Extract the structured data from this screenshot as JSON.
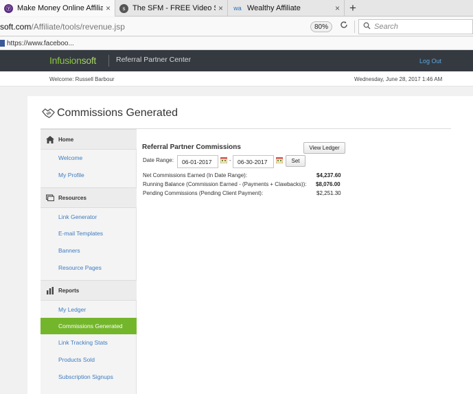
{
  "browser": {
    "tabs": [
      {
        "title": "Make Money Online Affiliate",
        "close": "×"
      },
      {
        "title": "The SFM - FREE Video Series",
        "close": "×"
      },
      {
        "title": "Wealthy Affiliate",
        "close": "×"
      }
    ],
    "new_tab": "+",
    "url_host": "soft.com",
    "url_path": "/Affiliate/tools/revenue.jsp",
    "zoom": "80%",
    "search_placeholder": "Search",
    "bookmark": "https://www.faceboo..."
  },
  "header": {
    "logo_main": "Infusion",
    "logo_soft": "soft",
    "center_name": "Referral Partner Center",
    "logout": "Log Out"
  },
  "welcome": {
    "text": "Welcome: Russell Barbour",
    "datetime": "Wednesday, June 28, 2017 1:46 AM"
  },
  "page": {
    "title": "Commissions Generated"
  },
  "sidebar": {
    "home": "Home",
    "home_items": [
      "Welcome",
      "My Profile"
    ],
    "resources": "Resources",
    "resource_items": [
      "Link Generator",
      "E-mail Templates",
      "Banners",
      "Resource Pages"
    ],
    "reports": "Reports",
    "report_items": [
      "My Ledger",
      "Commissions Generated",
      "Link Tracking Stats",
      "Products Sold",
      "Subscription Signups"
    ]
  },
  "main": {
    "heading": "Referral Partner Commissions",
    "view_ledger": "View Ledger",
    "date_range_label": "Date Range:",
    "start_date": "06-01-2017",
    "end_date": "06-30-2017",
    "dash": "-",
    "set": "Set",
    "rows": [
      {
        "label": "Net Commissions Earned (In Date Range):",
        "value": "$4,237.60"
      },
      {
        "label": "Running Balance (Commission Earned - (Payments + Clawbacks)):",
        "value": "$8,076.00"
      },
      {
        "label": "Pending Commissions (Pending Client Payment):",
        "value": "$2,251.30"
      }
    ]
  },
  "colors": {
    "accent_green": "#74b62b",
    "header_dark": "#353a41",
    "link_blue": "#3c7bc0"
  }
}
